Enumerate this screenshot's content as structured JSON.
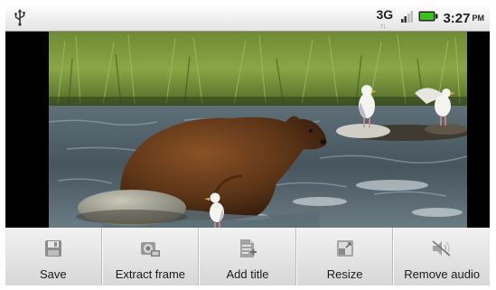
{
  "status_bar": {
    "usb_icon": "usb-icon",
    "network": "3G",
    "network_arrows": "↑↓",
    "signal_icon": "signal-bars-icon",
    "battery_icon": "battery-icon",
    "battery_color": "#3ac41a",
    "time": "3:27",
    "ampm": "PM"
  },
  "video": {
    "content": "video-preview"
  },
  "toolbar": {
    "items": [
      {
        "label": "Save",
        "icon": "save-icon"
      },
      {
        "label": "Extract frame",
        "icon": "extract-frame-icon"
      },
      {
        "label": "Add title",
        "icon": "add-title-icon"
      },
      {
        "label": "Resize",
        "icon": "resize-icon"
      },
      {
        "label": "Remove audio",
        "icon": "remove-audio-icon"
      }
    ]
  }
}
